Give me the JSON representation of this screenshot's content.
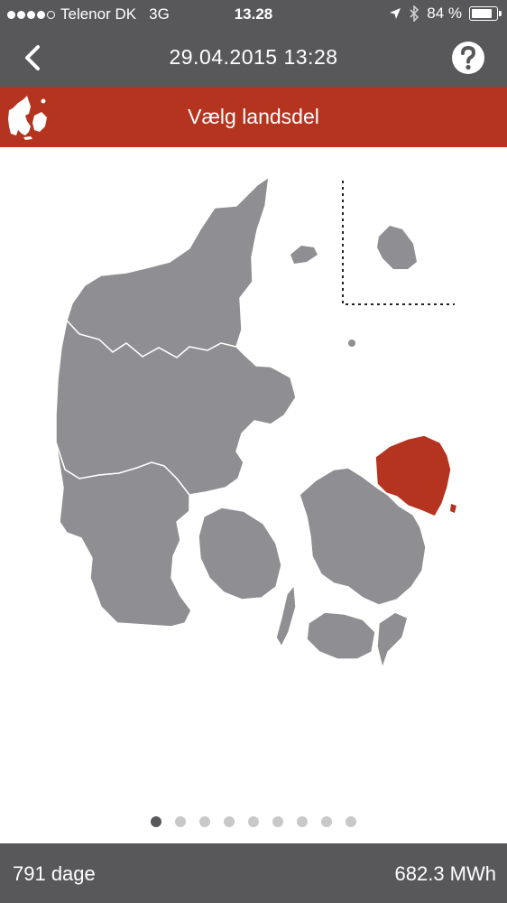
{
  "status_bar": {
    "carrier": "Telenor DK",
    "network": "3G",
    "time": "13.28",
    "battery_text": "84 %",
    "battery_level": 0.84
  },
  "nav": {
    "title": "29.04.2015 13:28",
    "back_icon": "chevron-left-icon",
    "help_icon": "question-circle-icon"
  },
  "region_header": {
    "title": "Vælg landsdel",
    "logo_icon": "denmark-map-icon"
  },
  "map": {
    "selected_region": "Hovedstaden",
    "colors": {
      "land": "#8f8e92",
      "selected": "#b5341f",
      "border": "#ffffff"
    }
  },
  "pager": {
    "count": 9,
    "active_index": 0
  },
  "footer": {
    "days": "791 dage",
    "energy": "682.3 MWh"
  },
  "colors": {
    "bar": "#58585a",
    "accent": "#b5341f"
  }
}
